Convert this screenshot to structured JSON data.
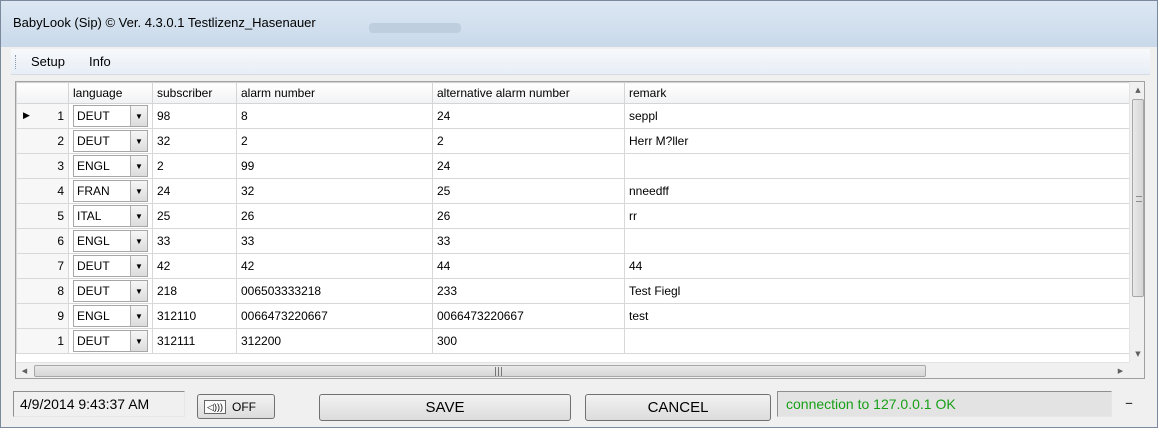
{
  "window": {
    "title": "BabyLook (Sip) © Ver. 4.3.0.1 Testlizenz_Hasenauer"
  },
  "menu": {
    "setup": "Setup",
    "info": "Info"
  },
  "grid": {
    "headers": {
      "language": "language",
      "subscriber": "subscriber",
      "alarm_number": "alarm number",
      "alt_alarm_number": "alternative alarm number",
      "remark": "remark"
    },
    "rows": [
      {
        "n": "1",
        "language": "DEUT",
        "subscriber": "98",
        "alarm": "8",
        "alt": "24",
        "remark": "seppl"
      },
      {
        "n": "2",
        "language": "DEUT",
        "subscriber": "32",
        "alarm": "2",
        "alt": "2",
        "remark": "Herr M?ller"
      },
      {
        "n": "3",
        "language": "ENGL",
        "subscriber": "2",
        "alarm": "99",
        "alt": "24",
        "remark": ""
      },
      {
        "n": "4",
        "language": "FRAN",
        "subscriber": "24",
        "alarm": "32",
        "alt": "25",
        "remark": "nneedff"
      },
      {
        "n": "5",
        "language": "ITAL",
        "subscriber": "25",
        "alarm": "26",
        "alt": "26",
        "remark": "rr"
      },
      {
        "n": "6",
        "language": "ENGL",
        "subscriber": "33",
        "alarm": "33",
        "alt": "33",
        "remark": ""
      },
      {
        "n": "7",
        "language": "DEUT",
        "subscriber": "42",
        "alarm": "42",
        "alt": "44",
        "remark": "44"
      },
      {
        "n": "8",
        "language": "DEUT",
        "subscriber": "218",
        "alarm": "006503333218",
        "alt": "233",
        "remark": "Test Fiegl"
      },
      {
        "n": "9",
        "language": "ENGL",
        "subscriber": "312110",
        "alarm": "0066473220667",
        "alt": "0066473220667",
        "remark": "test"
      },
      {
        "n": "1",
        "language": "DEUT",
        "subscriber": "312111",
        "alarm": "312200",
        "alt": "300",
        "remark": ""
      }
    ]
  },
  "status": {
    "datetime": "4/9/2014 9:43:37 AM",
    "sound_label": "OFF",
    "save_label": "SAVE",
    "cancel_label": "CANCEL",
    "connection": "connection to  127.0.0.1 OK",
    "minimize": "–"
  },
  "colors": {
    "connection_ok": "#17a017"
  }
}
